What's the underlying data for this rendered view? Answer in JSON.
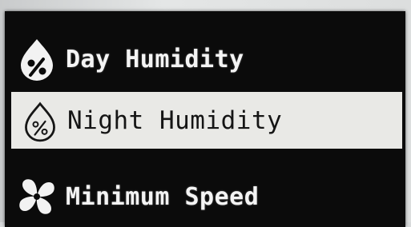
{
  "menu": {
    "items": [
      {
        "label": "Day Humidity",
        "icon": "humidity-drop-icon",
        "selected": false
      },
      {
        "label": "Night Humidity",
        "icon": "humidity-drop-icon",
        "selected": true
      },
      {
        "label": "Minimum Speed",
        "icon": "fan-icon",
        "selected": false
      }
    ]
  },
  "colors": {
    "screen_background": "#0b0b0b",
    "text": "#f4f4f4",
    "selected_background": "#e9e9e6",
    "selected_text": "#151515"
  }
}
